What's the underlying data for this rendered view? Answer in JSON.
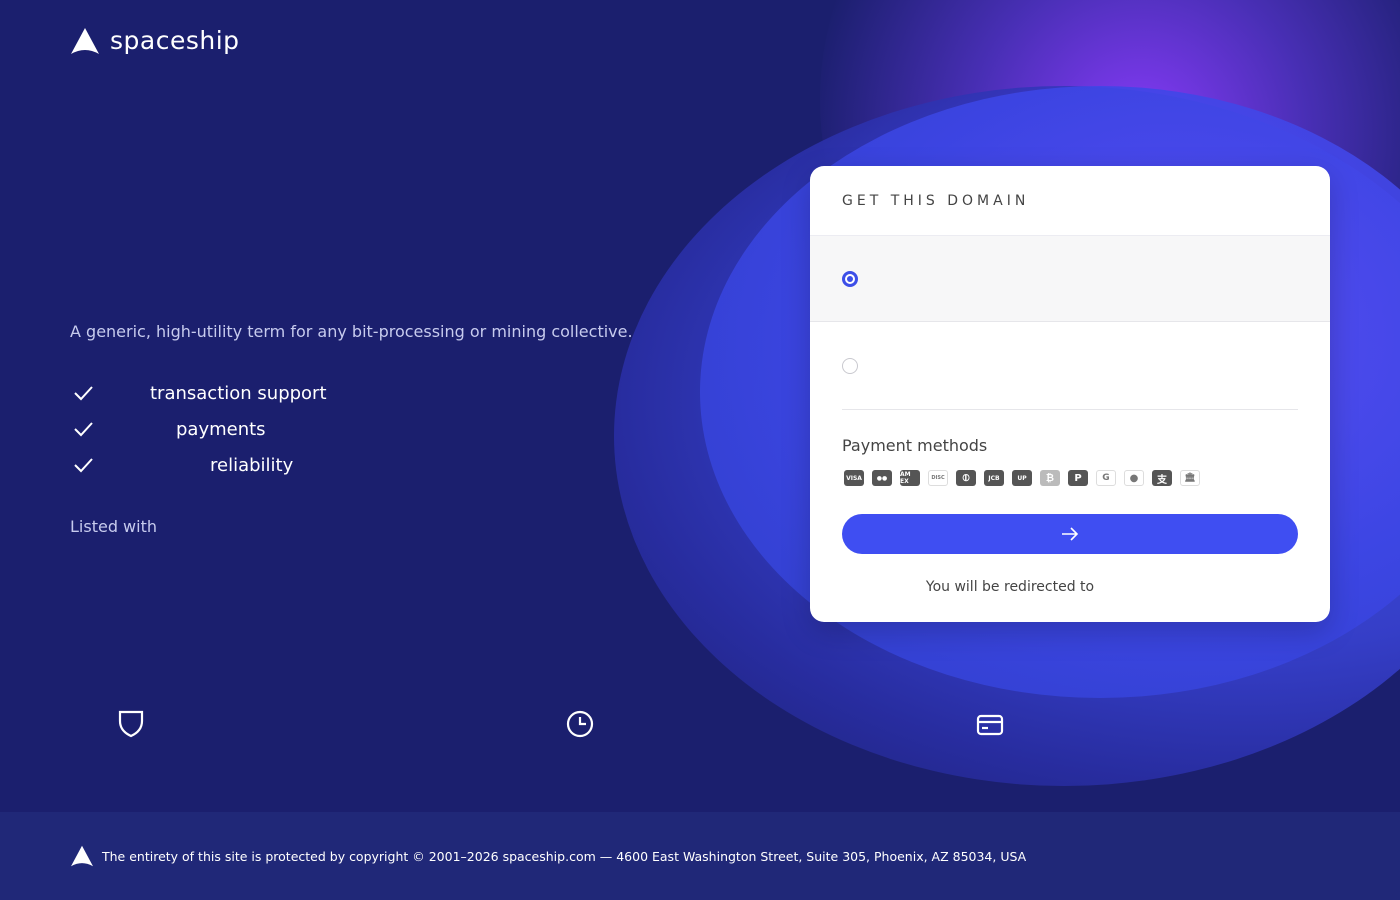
{
  "brand": {
    "name": "spaceship",
    "logo_icon": "spaceship-logo-icon"
  },
  "hero": {
    "description": "A generic, high-utility term for any bit-processing or mining collective.",
    "features": [
      {
        "icon": "check-icon",
        "label": "transaction support"
      },
      {
        "icon": "check-icon",
        "label": "payments"
      },
      {
        "icon": "check-icon",
        "label": "reliability"
      }
    ],
    "listed_with": "Listed with"
  },
  "trust_icons": [
    "shield-icon",
    "clock-icon",
    "credit-card-icon"
  ],
  "card": {
    "title": "GET THIS DOMAIN",
    "options": [
      {
        "selected": true
      },
      {
        "selected": false
      }
    ],
    "payment_methods_label": "Payment methods",
    "payment_methods": [
      {
        "name": "visa",
        "text": "VISA"
      },
      {
        "name": "mastercard",
        "text": "●●"
      },
      {
        "name": "amex",
        "text": "AM EX"
      },
      {
        "name": "discover",
        "text": "DISC"
      },
      {
        "name": "diners",
        "text": "⦶"
      },
      {
        "name": "jcb",
        "text": "JCB"
      },
      {
        "name": "unionpay",
        "text": "UP"
      },
      {
        "name": "bitcoin",
        "text": "₿"
      },
      {
        "name": "paypal",
        "text": "P"
      },
      {
        "name": "google-pay",
        "text": "G"
      },
      {
        "name": "apple-pay",
        "text": ""
      },
      {
        "name": "alipay",
        "text": "支"
      },
      {
        "name": "bank-transfer",
        "text": "🏛"
      }
    ],
    "submit_icon": "arrow-right-icon",
    "redirect_text": "You will be redirected to"
  },
  "footer": {
    "text": "The entirety of this site is protected by copyright © 2001–2026 spaceship.com — 4600 East Washington Street, Suite 305, Phoenix, AZ 85034, USA"
  },
  "colors": {
    "accent": "#3f4ef2",
    "background": "#1b1f6e",
    "footer": "#202878"
  }
}
